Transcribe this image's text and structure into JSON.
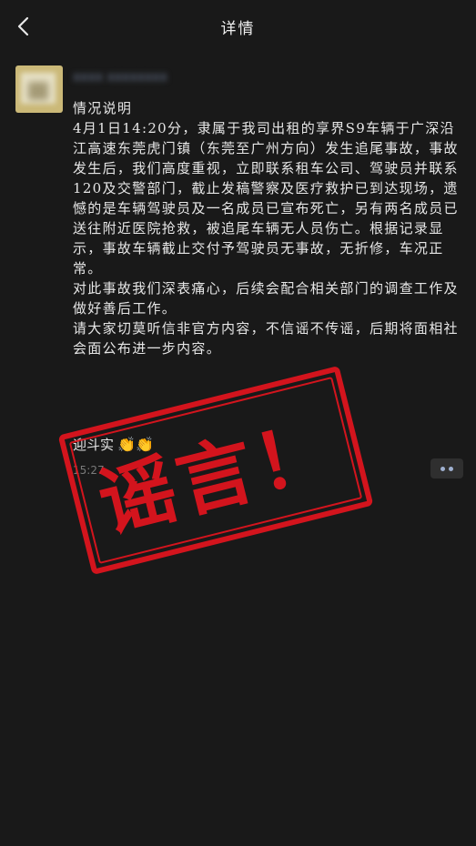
{
  "header": {
    "title": "详情",
    "back_icon": "chevron-left-icon"
  },
  "post": {
    "username": "xxxx xxxxxxxx",
    "heading": "情况说明",
    "paragraphs": [
      "4月1日14:20分，隶属于我司出租的享界S9车辆于广深沿江高速东莞虎门镇（东莞至广州方向）发生追尾事故，事故发生后，我们高度重视，立即联系租车公司、驾驶员并联系120及交警部门，截止发稿警察及医疗救护已到达现场，遗憾的是车辆驾驶员及一名成员已宣布死亡，另有两名成员已送往附近医院抢救，被追尾车辆无人员伤亡。根据记录显示，事故车辆截止交付予驾驶员无事故，无折修，车况正常。",
      "对此事故我们深表痛心，后续会配合相关部门的调查工作及做好善后工作。",
      "请大家切莫听信非官方内容，不信谣不传谣，后期将面相社会面公布进一步内容。"
    ],
    "sign": "迎斗实",
    "sign_emoji": "👏👏",
    "time": "15:27",
    "stamp_text": "谣言！"
  }
}
